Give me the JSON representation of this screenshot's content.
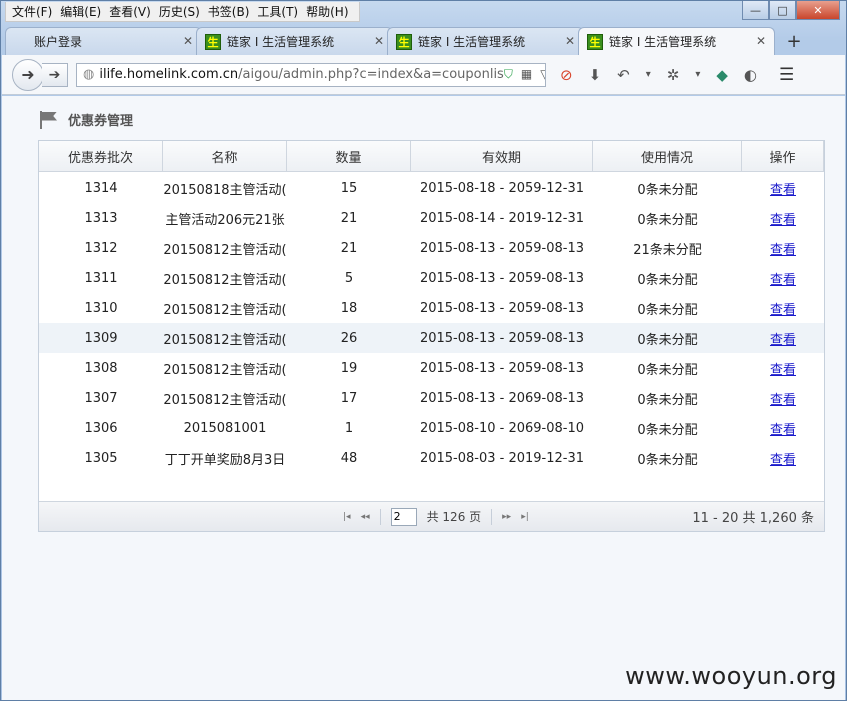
{
  "menubar": {
    "items": [
      "文件(F)",
      "编辑(E)",
      "查看(V)",
      "历史(S)",
      "书签(B)",
      "工具(T)",
      "帮助(H)"
    ]
  },
  "window_controls": {
    "min": "—",
    "max": "□",
    "close": "✕"
  },
  "tabs": [
    {
      "label": "账户登录",
      "favicon": ""
    },
    {
      "label": "链家 I 生活管理系统",
      "favicon": "生"
    },
    {
      "label": "链家 I 生活管理系统",
      "favicon": "生"
    },
    {
      "label": "链家 I 生活管理系统",
      "favicon": "生",
      "active": true
    }
  ],
  "navbar": {
    "url_domain": "ilife.homelink.com.cn",
    "url_path": "/aigou/admin.php?c=index&a=couponlis"
  },
  "page": {
    "title": "优惠券管理"
  },
  "table": {
    "headers": [
      "优惠券批次",
      "名称",
      "数量",
      "有效期",
      "使用情况",
      "操作"
    ],
    "rows": [
      {
        "id": "1314",
        "name": "20150818主管活动(",
        "qty": "15",
        "period": "2015-08-18 - 2059-12-31",
        "usage": "0条未分配",
        "action": "查看"
      },
      {
        "id": "1313",
        "name": "主管活动206元21张",
        "qty": "21",
        "period": "2015-08-14 - 2019-12-31",
        "usage": "0条未分配",
        "action": "查看"
      },
      {
        "id": "1312",
        "name": "20150812主管活动(",
        "qty": "21",
        "period": "2015-08-13 - 2059-08-13",
        "usage": "21条未分配",
        "action": "查看"
      },
      {
        "id": "1311",
        "name": "20150812主管活动(",
        "qty": "5",
        "period": "2015-08-13 - 2059-08-13",
        "usage": "0条未分配",
        "action": "查看"
      },
      {
        "id": "1310",
        "name": "20150812主管活动(",
        "qty": "18",
        "period": "2015-08-13 - 2059-08-13",
        "usage": "0条未分配",
        "action": "查看"
      },
      {
        "id": "1309",
        "name": "20150812主管活动(",
        "qty": "26",
        "period": "2015-08-13 - 2059-08-13",
        "usage": "0条未分配",
        "action": "查看"
      },
      {
        "id": "1308",
        "name": "20150812主管活动(",
        "qty": "19",
        "period": "2015-08-13 - 2059-08-13",
        "usage": "0条未分配",
        "action": "查看"
      },
      {
        "id": "1307",
        "name": "20150812主管活动(",
        "qty": "17",
        "period": "2015-08-13 - 2069-08-13",
        "usage": "0条未分配",
        "action": "查看"
      },
      {
        "id": "1306",
        "name": "2015081001",
        "qty": "1",
        "period": "2015-08-10 - 2069-08-10",
        "usage": "0条未分配",
        "action": "查看"
      },
      {
        "id": "1305",
        "name": "丁丁开单奖励8月3日",
        "qty": "48",
        "period": "2015-08-03 - 2019-12-31",
        "usage": "0条未分配",
        "action": "查看"
      }
    ],
    "highlighted_row": 5
  },
  "pager": {
    "page": "2",
    "total_pages_text": "共 126 页",
    "range_text": "11 - 20  共 1,260 条"
  },
  "watermark": "www.wooyun.org"
}
